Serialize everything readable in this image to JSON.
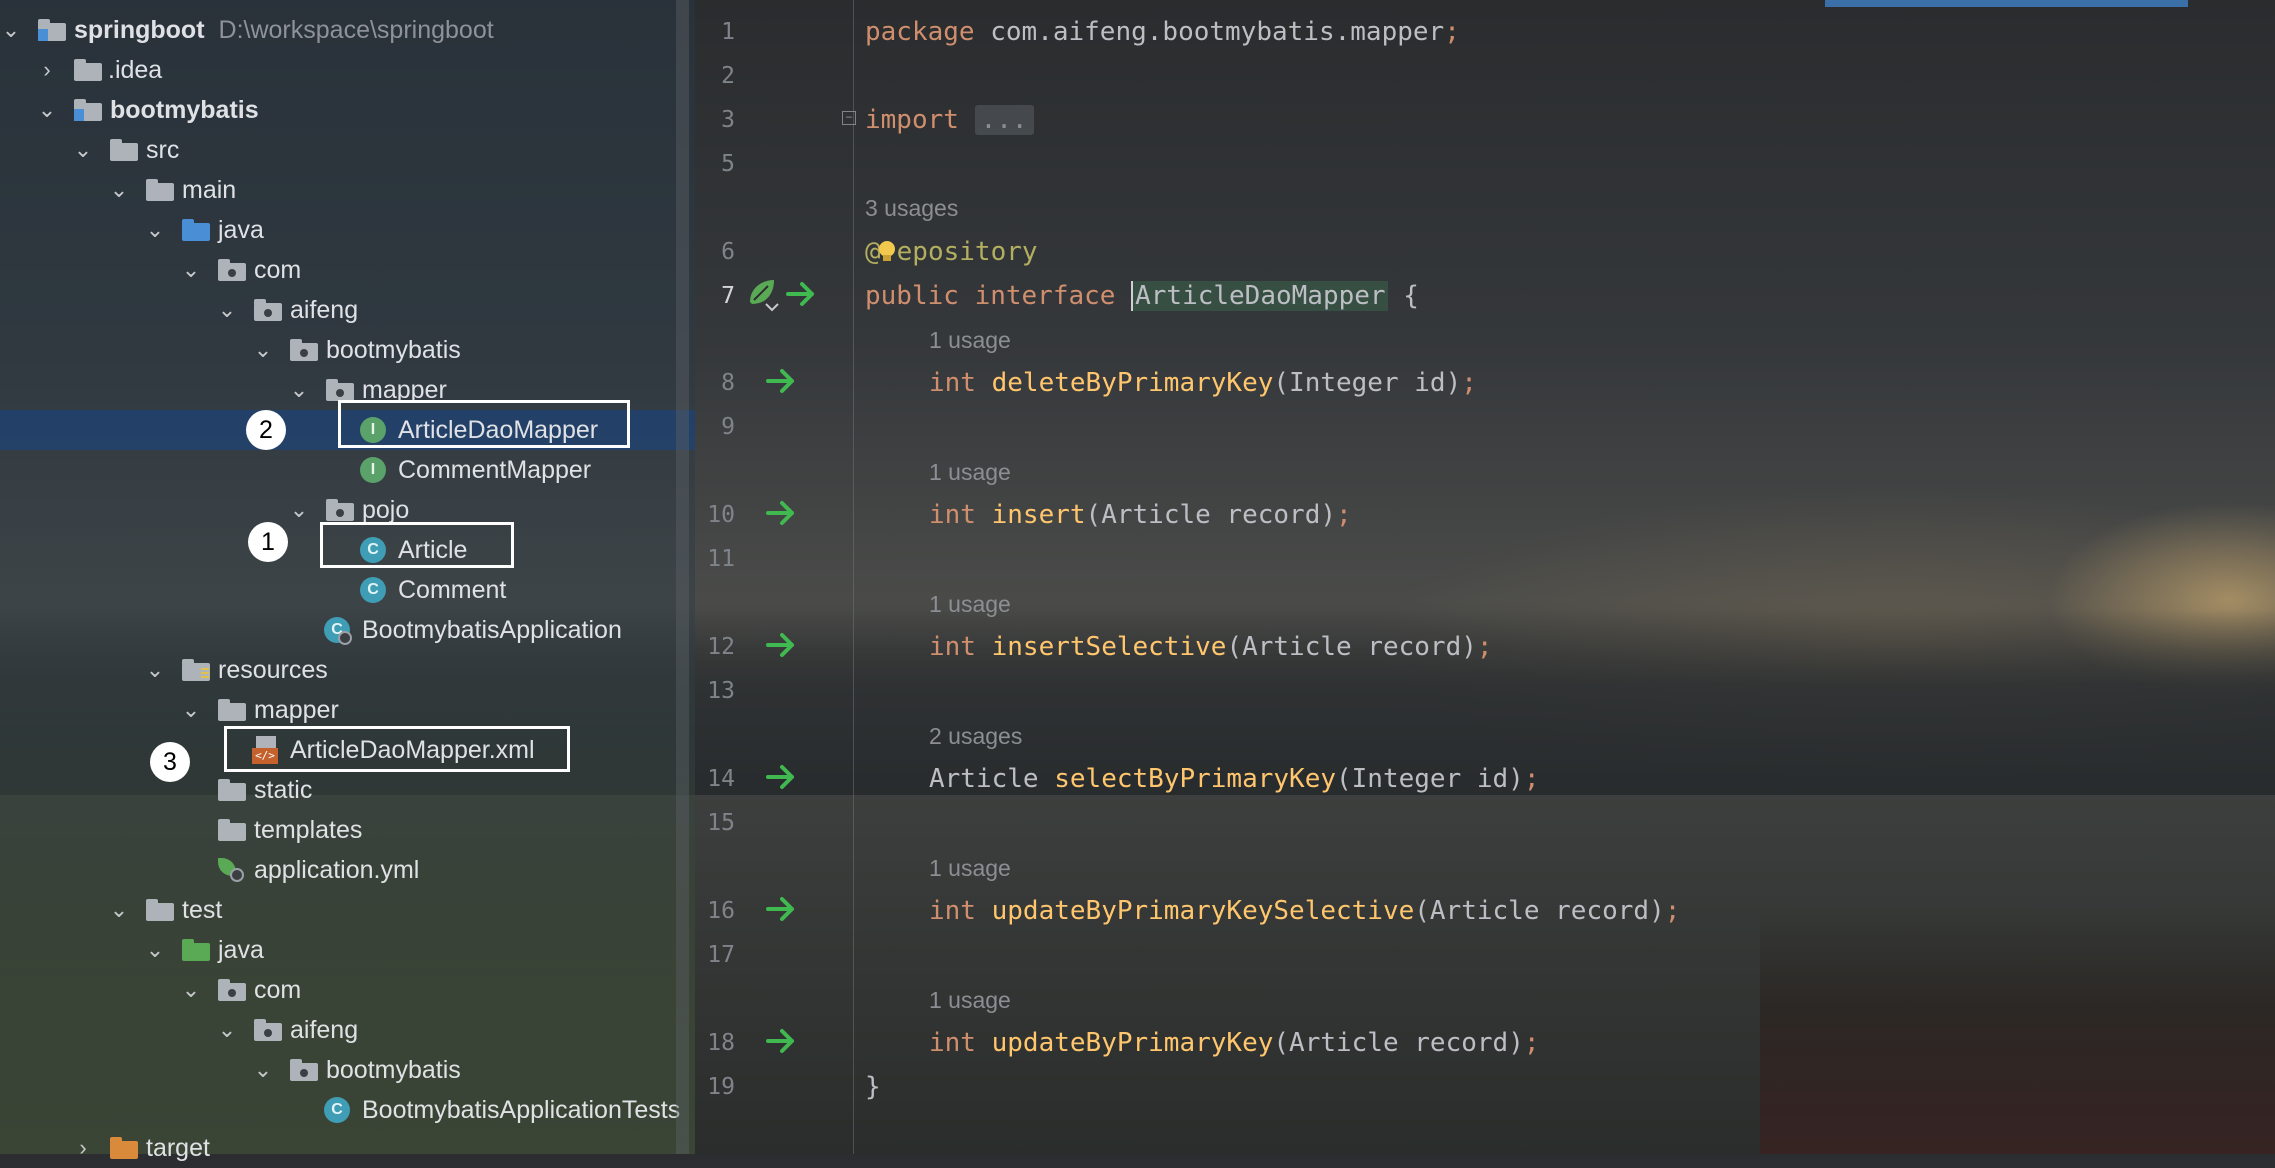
{
  "project_tree": {
    "root": {
      "label": "springboot",
      "path": "D:\\workspace\\springboot"
    },
    "idea": ".idea",
    "module": "bootmybatis",
    "src": "src",
    "main": "main",
    "java": "java",
    "com": "com",
    "aifeng": "aifeng",
    "bootmybatis_pkg": "bootmybatis",
    "mapper_pkg": "mapper",
    "article_dao_mapper": "ArticleDaoMapper",
    "comment_mapper": "CommentMapper",
    "pojo": "pojo",
    "article": "Article",
    "comment": "Comment",
    "app_class": "BootmybatisApplication",
    "resources": "resources",
    "res_mapper": "mapper",
    "xml_file": "ArticleDaoMapper.xml",
    "static": "static",
    "templates": "templates",
    "application_yml": "application.yml",
    "test": "test",
    "test_java": "java",
    "test_com": "com",
    "test_aifeng": "aifeng",
    "test_bootmybatis": "bootmybatis",
    "test_class": "BootmybatisApplicationTests",
    "target": "target"
  },
  "annotations": {
    "n1": "1",
    "n2": "2",
    "n3": "3"
  },
  "editor": {
    "line_numbers": [
      "1",
      "2",
      "3",
      "5",
      "6",
      "7",
      "8",
      "9",
      "10",
      "11",
      "12",
      "13",
      "14",
      "15",
      "16",
      "17",
      "18",
      "19"
    ],
    "l1_kw": "package",
    "l1_rest": " com.aifeng.bootmybatis.mapper",
    "semicolon": ";",
    "l3_kw": "import",
    "l3_folded": "...",
    "usages_3": "3 usages",
    "usage_1": "1 usage",
    "usages_2": "2 usages",
    "l6_at": "@",
    "l6_ann": "epository",
    "l7_kw": "public interface",
    "l7_name": "ArticleDaoMapper",
    "l7_brace": " {",
    "int_kw": "int",
    "m1_name": "deleteByPrimaryKey",
    "m1_args": "(Integer id)",
    "m2_name": "insert",
    "m2_args": "(Article record)",
    "m3_name": "insertSelective",
    "m3_args": "(Article record)",
    "m4_type": "Article",
    "m4_name": "selectByPrimaryKey",
    "m4_args": "(Integer id)",
    "m5_name": "updateByPrimaryKeySelective",
    "m5_args": "(Article record)",
    "m6_name": "updateByPrimaryKey",
    "m6_args": "(Article record)",
    "close_brace": "}"
  },
  "colors": {
    "keyword": "#cf8e6d",
    "method": "#ffc66d",
    "annotation": "#b3ae60",
    "text": "#bcbec4",
    "selection": "#21426e",
    "gutter_arrow": "#3fb950"
  },
  "icons": [
    "chevron-down-icon",
    "chevron-right-icon",
    "folder-icon",
    "package-icon",
    "interface-icon",
    "class-icon",
    "spring-app-icon",
    "xml-mapper-icon",
    "spring-yml-icon",
    "implemented-arrow-icon",
    "spring-bean-icon",
    "intention-bulb-icon",
    "fold-icon"
  ]
}
